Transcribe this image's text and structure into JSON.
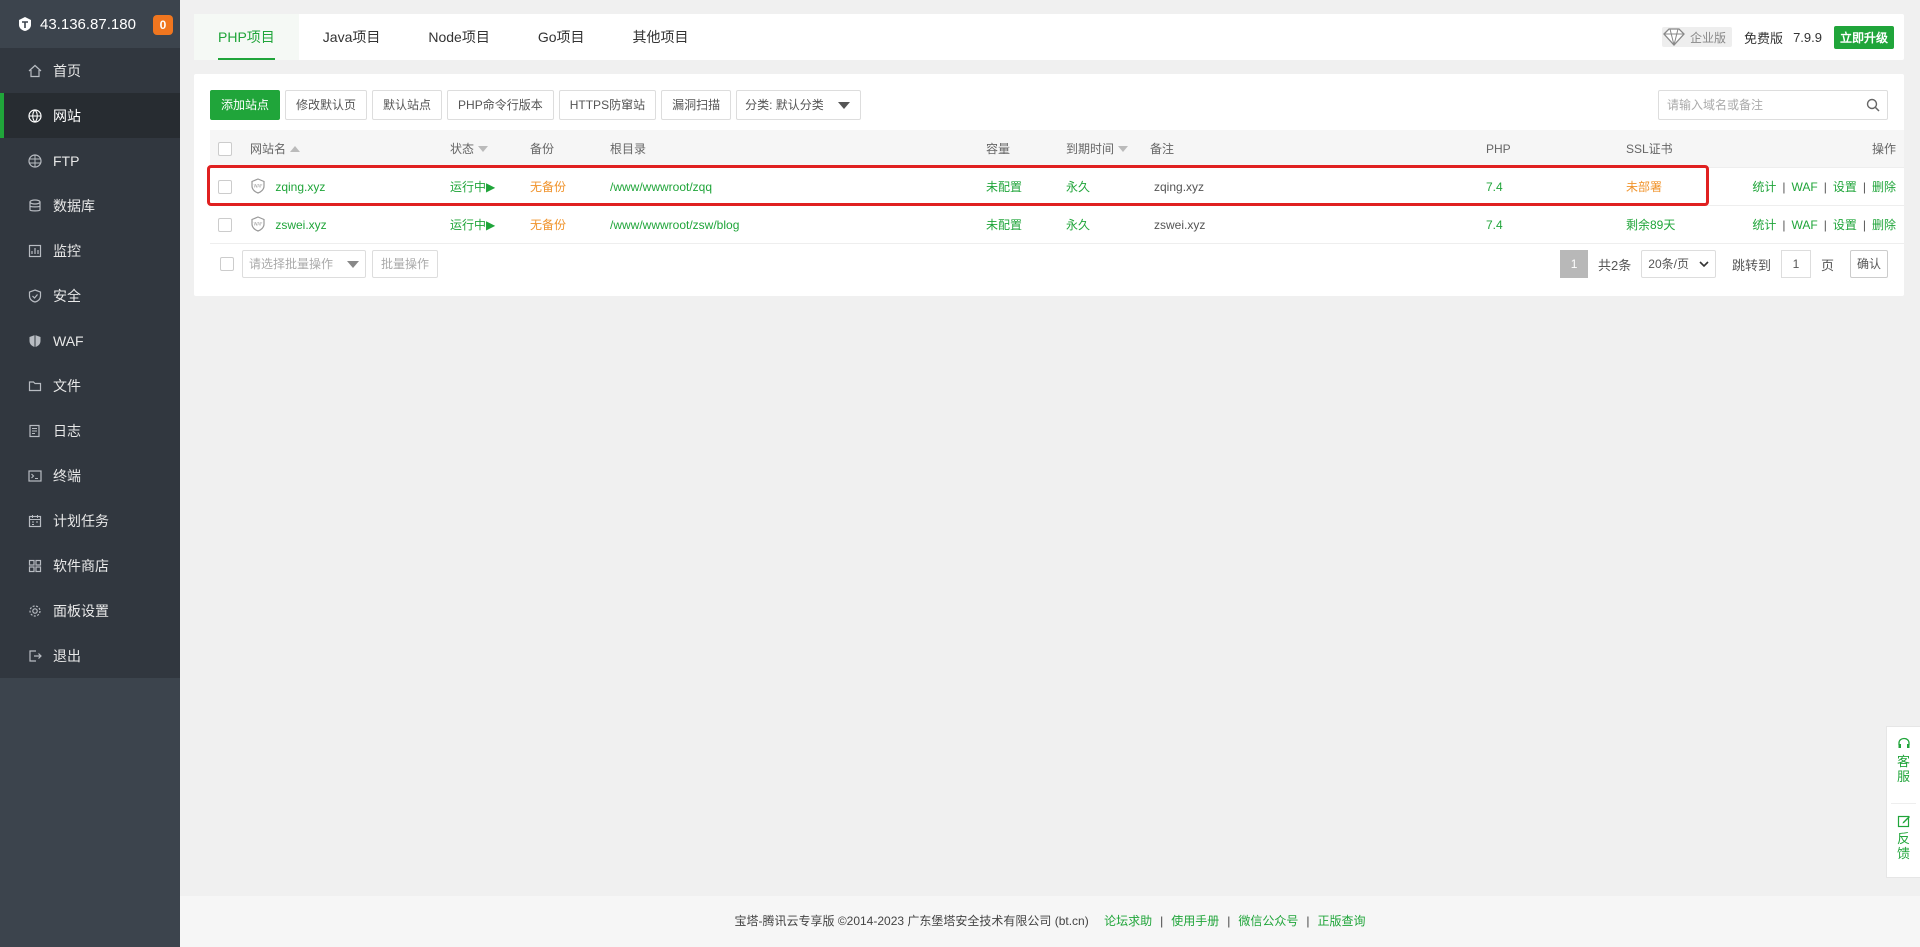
{
  "server": {
    "ip": "43.136.87.180",
    "badge": "0"
  },
  "sidebar": {
    "items": [
      {
        "label": "首页",
        "icon": "home-icon"
      },
      {
        "label": "网站",
        "icon": "globe-icon",
        "active": true
      },
      {
        "label": "FTP",
        "icon": "ftp-icon"
      },
      {
        "label": "数据库",
        "icon": "database-icon"
      },
      {
        "label": "监控",
        "icon": "monitor-icon"
      },
      {
        "label": "安全",
        "icon": "shield-icon"
      },
      {
        "label": "WAF",
        "icon": "waf-icon"
      },
      {
        "label": "文件",
        "icon": "folder-icon"
      },
      {
        "label": "日志",
        "icon": "log-icon"
      },
      {
        "label": "终端",
        "icon": "terminal-icon"
      },
      {
        "label": "计划任务",
        "icon": "calendar-icon"
      },
      {
        "label": "软件商店",
        "icon": "grid-icon"
      },
      {
        "label": "面板设置",
        "icon": "gear-icon"
      },
      {
        "label": "退出",
        "icon": "logout-icon"
      }
    ]
  },
  "tabs": [
    "PHP项目",
    "Java项目",
    "Node项目",
    "Go项目",
    "其他项目"
  ],
  "topright": {
    "edition": "企业版",
    "free": "免费版",
    "version": "7.9.9",
    "upgrade": "立即升级"
  },
  "toolbar": {
    "add_site": "添加站点",
    "modify_default": "修改默认页",
    "default_site": "默认站点",
    "php_cli": "PHP命令行版本",
    "https_guard": "HTTPS防窜站",
    "vuln_scan": "漏洞扫描",
    "category": "分类: 默认分类"
  },
  "search": {
    "placeholder": "请输入域名或备注"
  },
  "table": {
    "headers": {
      "name": "网站名",
      "status": "状态",
      "backup": "备份",
      "root": "根目录",
      "quota": "容量",
      "expire": "到期时间",
      "remark": "备注",
      "php": "PHP",
      "ssl": "SSL证书",
      "ops": "操作"
    },
    "rows": [
      {
        "name": "zqing.xyz",
        "status": "运行中▶",
        "backup": "无备份",
        "root": "/www/wwwroot/zqq",
        "quota": "未配置",
        "expire": "永久",
        "remark": "zqing.xyz",
        "php": "7.4",
        "ssl": "未部署"
      },
      {
        "name": "zswei.xyz",
        "status": "运行中▶",
        "backup": "无备份",
        "root": "/www/wwwroot/zsw/blog",
        "quota": "未配置",
        "expire": "永久",
        "remark": "zswei.xyz",
        "php": "7.4",
        "ssl": "剩余89天"
      }
    ],
    "ops": {
      "stats": "统计",
      "waf": "WAF",
      "settings": "设置",
      "delete": "删除",
      "sep": "|"
    }
  },
  "batch": {
    "placeholder": "请选择批量操作",
    "button": "批量操作"
  },
  "pager": {
    "current": "1",
    "total": "共2条",
    "page_size": "20条/页",
    "jump_label": "跳转到",
    "jump_value": "1",
    "page_unit": "页",
    "confirm": "确认"
  },
  "footer": {
    "copyright": "宝塔-腾讯云专享版 ©2014-2023 广东堡塔安全技术有限公司 (bt.cn)",
    "links": [
      "论坛求助",
      "使用手册",
      "微信公众号",
      "正版查询"
    ]
  },
  "float_service": {
    "service": [
      "客",
      "服"
    ],
    "feedback": [
      "反",
      "馈"
    ]
  },
  "colors": {
    "accent": "#20a53a",
    "warning": "#f0932b",
    "highlight": "#e02020",
    "sidebar": "#31373f"
  }
}
